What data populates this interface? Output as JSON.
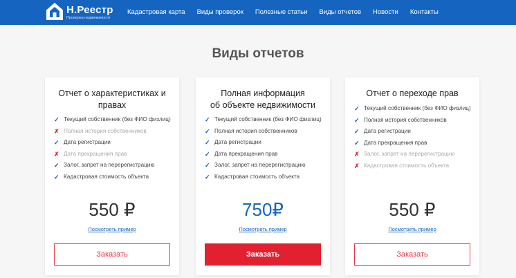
{
  "header": {
    "brand_name": "Н.Реестр",
    "brand_subtitle": "Проверка недвижимости",
    "nav": [
      "Кадастровая карта",
      "Виды проверок",
      "Полезные статьи",
      "Виды отчетов",
      "Новости",
      "Контакты"
    ],
    "bar_color": "#1565c0"
  },
  "page": {
    "title": "Виды отчетов"
  },
  "cards": [
    {
      "title": [
        "Отчет о характеристиках и",
        "правах"
      ],
      "features": [
        {
          "text": "Текущий собственник (без ФИО физлиц)",
          "included": true
        },
        {
          "text": "Полная история собственников",
          "included": false
        },
        {
          "text": "Дата регистрации",
          "included": true
        },
        {
          "text": "Дата прекращения прав",
          "included": false
        },
        {
          "text": "Залог, запрет на перерегистрацию",
          "included": true
        },
        {
          "text": "Кадастровая стоимость объекта",
          "included": true
        }
      ],
      "price": "550 ₽",
      "sample_link": "Посмотреть пример",
      "order_label": "Заказать",
      "featured": false
    },
    {
      "title": [
        "Полная информация",
        "об объекте недвижимости"
      ],
      "features": [
        {
          "text": "Текущий собственник (без ФИО физлиц)",
          "included": true
        },
        {
          "text": "Полная история собственников",
          "included": true
        },
        {
          "text": "Дата регистрации",
          "included": true
        },
        {
          "text": "Дата прекращения прав",
          "included": true
        },
        {
          "text": "Залог, запрет на перерегистрацию",
          "included": true
        },
        {
          "text": "Кадастровая стоимость объекта",
          "included": true
        }
      ],
      "price": "750₽",
      "sample_link": "Посмотреть пример",
      "order_label": "Заказать",
      "featured": true
    },
    {
      "title": [
        "Отчет о переходе прав"
      ],
      "features": [
        {
          "text": "Текущий собственник (без ФИО физлиц)",
          "included": true
        },
        {
          "text": "Полная история собственников",
          "included": true
        },
        {
          "text": "Дата регистрации",
          "included": true
        },
        {
          "text": "Дата прекращения прав",
          "included": true
        },
        {
          "text": "Залог, запрет на перерегистрацию",
          "included": false
        },
        {
          "text": "Кадастровая стоимость объекта",
          "included": false
        }
      ],
      "price": "550 ₽",
      "sample_link": "Посмотреть пример",
      "order_label": "Заказать",
      "featured": false
    }
  ]
}
